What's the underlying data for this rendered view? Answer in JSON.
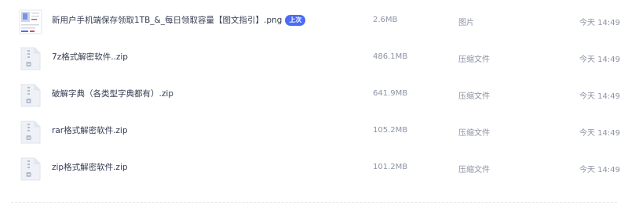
{
  "files": [
    {
      "name": "新用户手机端保存领取1TB_&_每日领取容量【图文指引】.png",
      "badge": "上次",
      "size": "2.6MB",
      "type": "图片",
      "time": "今天 14:49",
      "icon": "image-thumbnail-icon"
    },
    {
      "name": "7z格式解密软件..zip",
      "size": "486.1MB",
      "type": "压缩文件",
      "time": "今天 14:49",
      "icon": "zip-file-icon"
    },
    {
      "name": "破解字典（各类型字典都有）.zip",
      "size": "641.9MB",
      "type": "压缩文件",
      "time": "今天 14:49",
      "icon": "zip-file-icon"
    },
    {
      "name": "rar格式解密软件.zip",
      "size": "105.2MB",
      "type": "压缩文件",
      "time": "今天 14:49",
      "icon": "zip-file-icon"
    },
    {
      "name": "zip格式解密软件.zip",
      "size": "101.2MB",
      "type": "压缩文件",
      "time": "今天 14:49",
      "icon": "zip-file-icon"
    }
  ],
  "colors": {
    "badge": "#4b6cf5",
    "name_text": "#353d52",
    "meta_text": "#8d93a5",
    "zip_icon_body": "#eef1f6",
    "zip_icon_mark": "#b4bccb"
  }
}
